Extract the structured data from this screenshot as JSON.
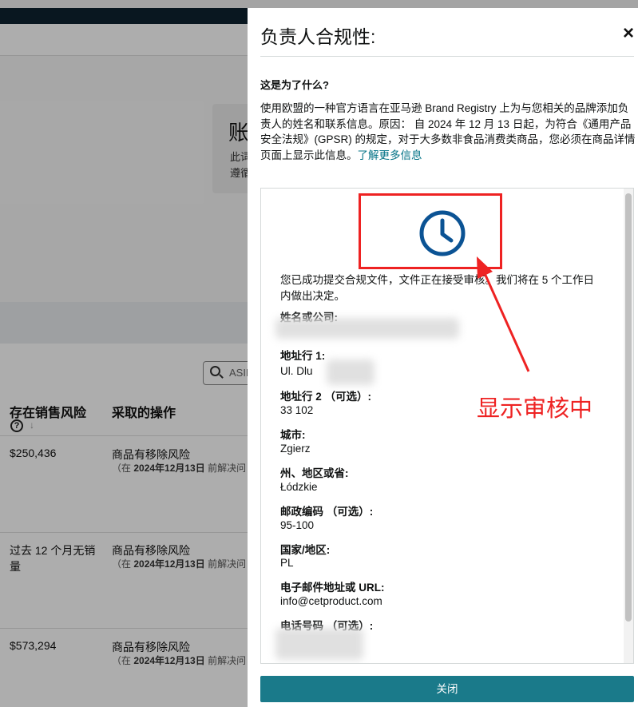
{
  "background": {
    "card": {
      "title": "账",
      "line1": "此词",
      "line2": "遵循"
    },
    "search_placeholder": "ASIN",
    "columns": {
      "risk": "存在销售风险",
      "action": "采取的操作"
    },
    "rows": [
      {
        "risk": "$250,436",
        "action": "商品有移除风险",
        "note_prefix": "（在 ",
        "note_date": "2024年12月13日",
        "note_suffix": " 前解决问"
      },
      {
        "risk": "过去 12 个月无销量",
        "action": "商品有移除风险",
        "note_prefix": "（在 ",
        "note_date": "2024年12月13日",
        "note_suffix": " 前解决问"
      },
      {
        "risk": "$573,294",
        "action": "商品有移除风险",
        "note_prefix": "（在 ",
        "note_date": "2024年12月13日",
        "note_suffix": " 前解决问"
      }
    ]
  },
  "modal": {
    "title": "负责人合规性:",
    "close_glyph": "×",
    "subheading": "这是为了什么?",
    "paragraph": "使用欧盟的一种官方语言在亚马逊 Brand Registry 上为与您相关的品牌添加负责人的姓名和联系信息。原因： 自 2024 年 12 月 13 日起，为符合《通用产品安全法规》(GPSR) 的规定，对于大多数非食品消费类商品，您必须在商品详情页面上显示此信息。",
    "link": "了解更多信息",
    "status_message": "您已成功提交合规文件，文件正在接受审核。我们将在 5 个工作日内做出决定。",
    "fields": {
      "name_label": "姓名或公司:",
      "addr1_label": "地址行 1:",
      "addr1_value": "Ul. Dlu",
      "addr2_label": "地址行 2 （可选）:",
      "addr2_value": "33 102",
      "city_label": "城市:",
      "city_value": "Zgierz",
      "state_label": "州、地区或省:",
      "state_value": "Łódzkie",
      "zip_label": "邮政编码 （可选）:",
      "zip_value": "95-100",
      "country_label": "国家/地区:",
      "country_value": "PL",
      "email_label": "电子邮件地址或 URL:",
      "email_value": "info@cetproduct.com",
      "phone_label": "电话号码 （可选）:"
    },
    "close_button": "关闭"
  },
  "annotation": {
    "text": "显示审核中",
    "color": "#ee2222"
  },
  "colors": {
    "link": "#007185",
    "button": "#1a7a8a",
    "clock": "#0b5394"
  }
}
